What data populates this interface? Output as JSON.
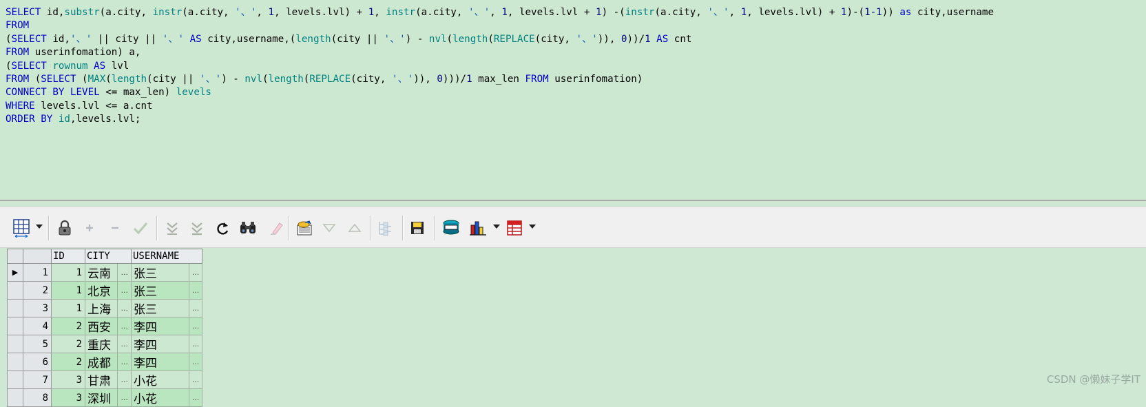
{
  "editor": {
    "lines": [
      [
        [
          "kw",
          "SELECT"
        ],
        [
          "id",
          " id,"
        ],
        [
          "fn",
          "substr"
        ],
        [
          "op",
          "(a.city, "
        ],
        [
          "fn",
          "instr"
        ],
        [
          "op",
          "(a.city, "
        ],
        [
          "str",
          "'、'"
        ],
        [
          "op",
          ", "
        ],
        [
          "num",
          "1"
        ],
        [
          "op",
          ", levels.lvl) + "
        ],
        [
          "num",
          "1"
        ],
        [
          "op",
          ", "
        ],
        [
          "fn",
          "instr"
        ],
        [
          "op",
          "(a.city, "
        ],
        [
          "str",
          "'、'"
        ],
        [
          "op",
          ", "
        ],
        [
          "num",
          "1"
        ],
        [
          "op",
          ", levels.lvl + "
        ],
        [
          "num",
          "1"
        ],
        [
          "op",
          ") -("
        ],
        [
          "fn",
          "instr"
        ],
        [
          "op",
          "(a.city, "
        ],
        [
          "str",
          "'、'"
        ],
        [
          "op",
          ", "
        ],
        [
          "num",
          "1"
        ],
        [
          "op",
          ", levels.lvl) + "
        ],
        [
          "num",
          "1"
        ],
        [
          "op",
          ")-("
        ],
        [
          "num",
          "1-1"
        ],
        [
          "op",
          ")) "
        ],
        [
          "kw",
          "as"
        ],
        [
          "id",
          " city,username"
        ]
      ],
      [
        [
          "kw",
          "FROM"
        ]
      ],
      [
        [
          "op",
          "("
        ],
        [
          "kw",
          "SELECT"
        ],
        [
          "id",
          " id,"
        ],
        [
          "str",
          "'、'"
        ],
        [
          "op",
          " || city || "
        ],
        [
          "str",
          "'、'"
        ],
        [
          "kw",
          " AS"
        ],
        [
          "id",
          " city,username,("
        ],
        [
          "fn",
          "length"
        ],
        [
          "op",
          "(city || "
        ],
        [
          "str",
          "'、'"
        ],
        [
          "op",
          ") - "
        ],
        [
          "fn",
          "nvl"
        ],
        [
          "op",
          "("
        ],
        [
          "fn",
          "length"
        ],
        [
          "op",
          "("
        ],
        [
          "fn",
          "REPLACE"
        ],
        [
          "op",
          "(city, "
        ],
        [
          "str",
          "'、'"
        ],
        [
          "op",
          ")), "
        ],
        [
          "num",
          "0"
        ],
        [
          "op",
          "))/"
        ],
        [
          "num",
          "1"
        ],
        [
          "kw",
          " AS"
        ],
        [
          "id",
          " cnt"
        ]
      ],
      [
        [
          "kw",
          "FROM"
        ],
        [
          "id",
          " userinfomation) a,"
        ]
      ],
      [
        [
          "op",
          "("
        ],
        [
          "kw",
          "SELECT"
        ],
        [
          "fn",
          " rownum"
        ],
        [
          "kw",
          " AS"
        ],
        [
          "id",
          " lvl"
        ]
      ],
      [
        [
          "kw",
          "FROM"
        ],
        [
          "op",
          " ("
        ],
        [
          "kw",
          "SELECT"
        ],
        [
          "op",
          " ("
        ],
        [
          "fn",
          "MAX"
        ],
        [
          "op",
          "("
        ],
        [
          "fn",
          "length"
        ],
        [
          "op",
          "(city || "
        ],
        [
          "str",
          "'、'"
        ],
        [
          "op",
          ") - "
        ],
        [
          "fn",
          "nvl"
        ],
        [
          "op",
          "("
        ],
        [
          "fn",
          "length"
        ],
        [
          "op",
          "("
        ],
        [
          "fn",
          "REPLACE"
        ],
        [
          "op",
          "(city, "
        ],
        [
          "str",
          "'、'"
        ],
        [
          "op",
          ")), "
        ],
        [
          "num",
          "0"
        ],
        [
          "op",
          ")))/"
        ],
        [
          "num",
          "1"
        ],
        [
          "id",
          " max_len "
        ],
        [
          "kw",
          "FROM"
        ],
        [
          "id",
          " userinfomation)"
        ]
      ],
      [
        [
          "kw",
          "CONNECT BY LEVEL"
        ],
        [
          "op",
          " <= max_len) "
        ],
        [
          "fn",
          "levels"
        ]
      ],
      [
        [
          "kw",
          "WHERE"
        ],
        [
          "id",
          " levels.lvl <= a.cnt"
        ]
      ],
      [
        [
          "kw",
          "ORDER BY"
        ],
        [
          "fn",
          " id"
        ],
        [
          "id",
          ",levels.lvl;"
        ]
      ]
    ]
  },
  "toolbar": {
    "icons": [
      "grid-select-icon",
      "lock-icon",
      "add-row-icon",
      "delete-row-icon",
      "post-changes-icon",
      "fetch-next-icon",
      "fetch-last-icon",
      "refresh-icon",
      "find-icon",
      "clear-icon",
      "query-by-example-icon",
      "next-record-icon",
      "previous-record-icon",
      "export-tree-icon",
      "save-icon",
      "connection-icon",
      "chart-icon",
      "export-table-icon"
    ]
  },
  "grid": {
    "columns": [
      "ID",
      "CITY",
      "USERNAME"
    ],
    "ellipsis": "…",
    "rows": [
      {
        "rownum": "1",
        "id": "1",
        "city": "云南",
        "username": "张三"
      },
      {
        "rownum": "2",
        "id": "1",
        "city": "北京",
        "username": "张三"
      },
      {
        "rownum": "3",
        "id": "1",
        "city": "上海",
        "username": "张三"
      },
      {
        "rownum": "4",
        "id": "2",
        "city": "西安",
        "username": "李四"
      },
      {
        "rownum": "5",
        "id": "2",
        "city": "重庆",
        "username": "李四"
      },
      {
        "rownum": "6",
        "id": "2",
        "city": "成都",
        "username": "李四"
      },
      {
        "rownum": "7",
        "id": "3",
        "city": "甘肃",
        "username": "小花"
      },
      {
        "rownum": "8",
        "id": "3",
        "city": "深圳",
        "username": "小花"
      }
    ]
  },
  "watermark": "CSDN @懒妹子学IT",
  "colors": {
    "keyword": "#0000c8",
    "function": "#008080",
    "editor_bg": "#cde8d1",
    "row_alt": "#b9e6bf"
  }
}
